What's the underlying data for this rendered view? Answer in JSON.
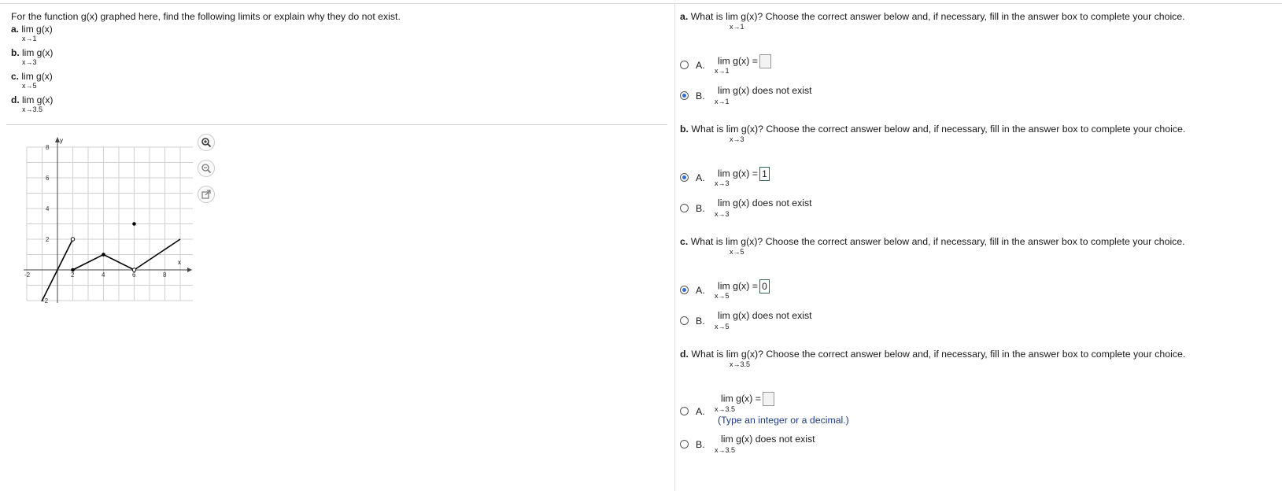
{
  "left": {
    "question": "For the function g(x) graphed here, find the following limits or explain why they do not exist.",
    "items": [
      {
        "letter": "a.",
        "expr": "lim g(x)",
        "sub": "x→1"
      },
      {
        "letter": "b.",
        "expr": "lim g(x)",
        "sub": "x→3"
      },
      {
        "letter": "c.",
        "expr": "lim g(x)",
        "sub": "x→5"
      },
      {
        "letter": "d.",
        "expr": "lim  g(x)",
        "sub": "x→3.5"
      }
    ],
    "graph": {
      "x_axis_label": "x",
      "y_axis_label": "y",
      "x_ticks": [
        "-2",
        "2",
        "4",
        "6",
        "8"
      ],
      "y_ticks": [
        "8",
        "6",
        "4",
        "2",
        "-2"
      ],
      "icons": [
        "zoom-in-icon",
        "zoom-out-icon",
        "popout-icon"
      ]
    }
  },
  "right": {
    "parts": [
      {
        "letter": "a.",
        "question_pre": "What is",
        "question_lim": "lim g(x)?",
        "question_post": "Choose the correct answer below and, if necessary, fill in the answer box to complete your choice.",
        "sub": "x→1",
        "optA": {
          "label": "A.",
          "expr": "lim g(x) =",
          "sub": "x→1",
          "answer": "",
          "selected": false
        },
        "optB": {
          "label": "B.",
          "expr": "lim g(x) does not exist",
          "sub": "x→1",
          "selected": true
        }
      },
      {
        "letter": "b.",
        "question_pre": "What is",
        "question_lim": "lim g(x)?",
        "question_post": "Choose the correct answer below and, if necessary, fill in the answer box to complete your choice.",
        "sub": "x→3",
        "optA": {
          "label": "A.",
          "expr": "lim g(x) =",
          "sub": "x→3",
          "answer": "1",
          "selected": true
        },
        "optB": {
          "label": "B.",
          "expr": "lim g(x) does not exist",
          "sub": "x→3",
          "selected": false
        }
      },
      {
        "letter": "c.",
        "question_pre": "What is",
        "question_lim": "lim g(x)?",
        "question_post": "Choose the correct answer below and, if necessary, fill in the answer box to complete your choice.",
        "sub": "x→5",
        "optA": {
          "label": "A.",
          "expr": "lim g(x) =",
          "sub": "x→5",
          "answer": "0",
          "selected": true
        },
        "optB": {
          "label": "B.",
          "expr": "lim g(x) does not exist",
          "sub": "x→5",
          "selected": false
        }
      },
      {
        "letter": "d.",
        "question_pre": "What is",
        "question_lim": "lim  g(x)?",
        "question_post": "Choose the correct answer below and, if necessary, fill in the answer box to complete your choice.",
        "sub": "x→3.5",
        "optA": {
          "label": "A.",
          "expr": "lim  g(x) =",
          "sub": "x→3.5",
          "answer": "",
          "selected": false,
          "hint": "(Type an integer or a decimal.)"
        },
        "optB": {
          "label": "B.",
          "expr": "lim  g(x) does not exist",
          "sub": "x→3.5",
          "selected": false
        }
      }
    ]
  }
}
